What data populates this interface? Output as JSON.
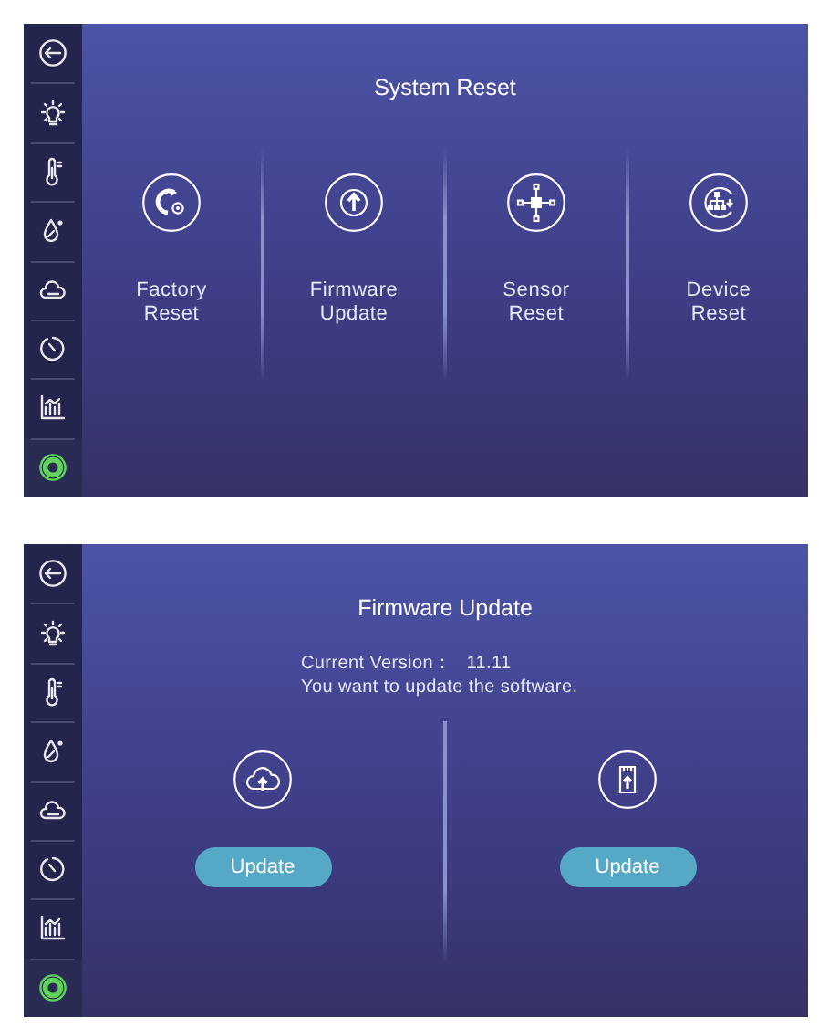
{
  "screens": [
    {
      "kind": "reset-menu",
      "title": "System Reset",
      "sidebar": [
        {
          "kind": "back",
          "selected": false
        },
        {
          "kind": "light",
          "selected": false
        },
        {
          "kind": "temperature",
          "selected": false
        },
        {
          "kind": "humidity",
          "selected": false
        },
        {
          "kind": "cloud",
          "selected": false
        },
        {
          "kind": "timer",
          "selected": false
        },
        {
          "kind": "chart",
          "selected": false
        },
        {
          "kind": "ring",
          "selected": true
        }
      ],
      "options": [
        {
          "kind": "factory",
          "label": "Factory Reset"
        },
        {
          "kind": "firmware",
          "label": "Firmware Update"
        },
        {
          "kind": "sensor",
          "label": "Sensor Reset"
        },
        {
          "kind": "device",
          "label": "Device Reset"
        }
      ]
    },
    {
      "kind": "firmware",
      "title": "Firmware Update",
      "sidebar": [
        {
          "kind": "back",
          "selected": false
        },
        {
          "kind": "light",
          "selected": false
        },
        {
          "kind": "temperature",
          "selected": false
        },
        {
          "kind": "humidity",
          "selected": false
        },
        {
          "kind": "cloud",
          "selected": false
        },
        {
          "kind": "timer",
          "selected": false
        },
        {
          "kind": "chart",
          "selected": false
        },
        {
          "kind": "ring",
          "selected": true
        }
      ],
      "version_label": "Current Version：",
      "version": "11.11",
      "message": "You want to update the software.",
      "sources": [
        {
          "kind": "cloud",
          "button": "Update"
        },
        {
          "kind": "sd-card",
          "button": "Update"
        }
      ]
    }
  ]
}
